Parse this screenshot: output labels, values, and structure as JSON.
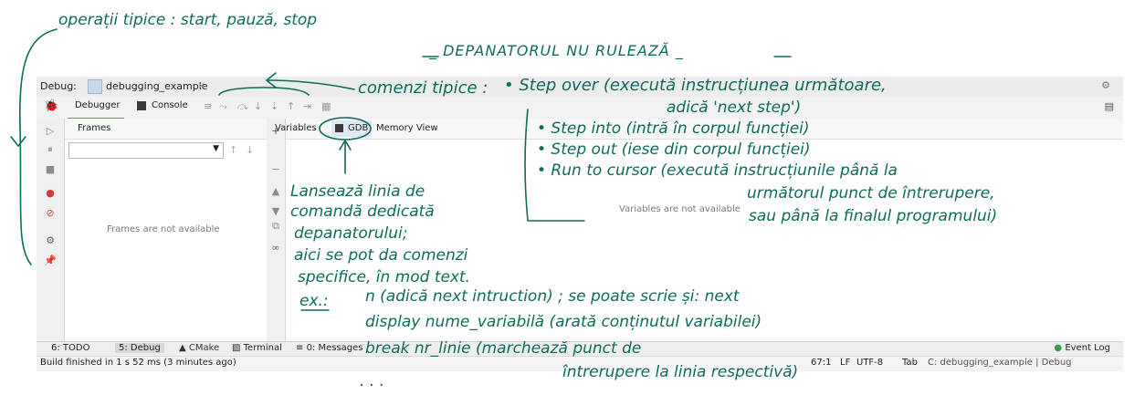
{
  "debug_bar": {
    "label": "Debug:",
    "config_name": "debugging_example"
  },
  "tabs": {
    "debugger": "Debugger",
    "console": "Console"
  },
  "frames": {
    "header": "Frames",
    "empty": "Frames are not available"
  },
  "variables": {
    "tab_variables": "Variables",
    "tab_gdb": "GDB",
    "tab_memory": "Memory View",
    "empty": "Variables are not available"
  },
  "bottom_tabs": {
    "todo": "6: TODO",
    "debug": "5: Debug",
    "cmake": "CMake",
    "terminal": "Terminal",
    "messages": "0: Messages",
    "event_log": "Event Log"
  },
  "status": {
    "message": "Build finished in 1 s 52 ms (3 minutes ago)",
    "position": "67:1",
    "line_sep": "LF",
    "encoding": "UTF-8",
    "indent": "Tab",
    "context": "C: debugging_example | Debug"
  },
  "annotations": {
    "typical_ops": "operații tipice : start, pauză, stop",
    "debugger_running": "_ DEPANATORUL NU RULEAZĂ _",
    "typical_commands_title": "comenzi tipice :",
    "step_over": "• Step over (execută instrucțiunea următoare,",
    "step_over_2": "adică 'next step')",
    "step_into": "• Step into (intră în corpul funcției)",
    "step_out": "• Step out (iese din corpul funcției)",
    "run_to_cursor": "• Run to cursor (execută instrucțiunile până la",
    "run_to_cursor_2": "următorul punct de întrerupere,",
    "run_to_cursor_3": "sau până la finalul programului)",
    "gdb_1": "Lansează linia de",
    "gdb_2": "comandă dedicată",
    "gdb_3": "depanatorului;",
    "gdb_4": "aici se pot da comenzi",
    "gdb_5": "specifice, în mod text.",
    "ex_label": "ex.:",
    "ex_1": "n (adică next intruction) ; se poate scrie și: next",
    "ex_2": "display nume_variabilă (arată conținutul variabilei)",
    "ex_3": "break nr_linie (marchează punct de",
    "ex_4": "întrerupere la linia respectivă)",
    "ellipsis": ". . ."
  }
}
